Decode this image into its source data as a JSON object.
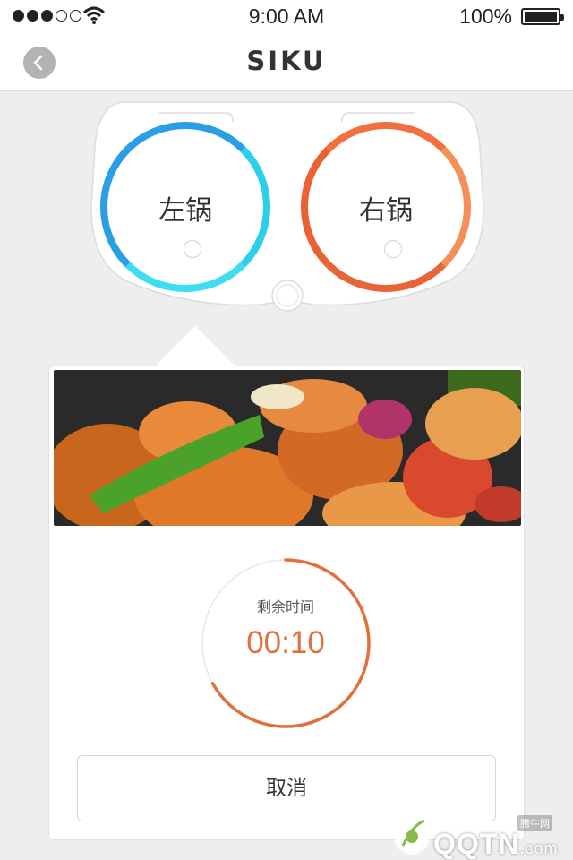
{
  "status_bar": {
    "time": "9:00 AM",
    "battery": "100%",
    "signal_icon": "signal-dots-icon",
    "wifi_icon": "wifi-icon",
    "battery_icon": "battery-icon"
  },
  "nav": {
    "title": "SIKU",
    "back_icon": "chevron-left-icon"
  },
  "cooker": {
    "left_pot": "左锅",
    "right_pot": "右锅",
    "left_color": "#2a9fe6",
    "right_color": "#ee6b3c"
  },
  "timer": {
    "label": "剩余时间",
    "value": "00:10",
    "progress": 0.67,
    "accent_color": "#e0703c"
  },
  "actions": {
    "cancel": "取消"
  },
  "watermark": {
    "small": "腾牛网",
    "text": "QQTN",
    "suffix": ".com"
  }
}
